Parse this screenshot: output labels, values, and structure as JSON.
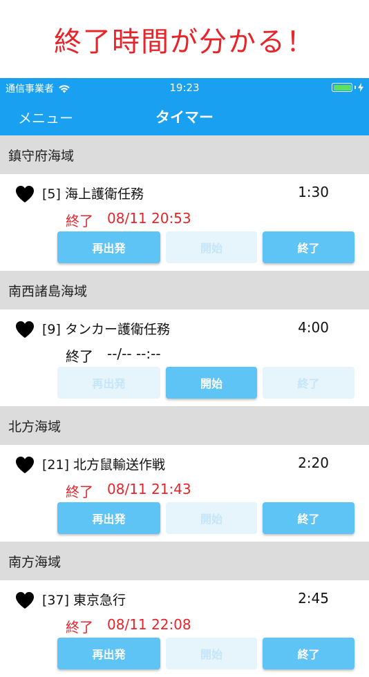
{
  "promo": {
    "text": "終了時間が分かる！"
  },
  "status_bar": {
    "carrier": "通信事業者",
    "time": "19:23"
  },
  "nav": {
    "menu_label": "メニュー",
    "title": "タイマー"
  },
  "sections": [
    {
      "header": "鎮守府海域",
      "item": {
        "name": "[5] 海上護衛任務",
        "duration": "1:30",
        "end_label": "終了",
        "end_time": "08/11 20:53",
        "end_color": "#e8242b",
        "buttons": [
          {
            "label": "再出発",
            "enabled": true
          },
          {
            "label": "開始",
            "enabled": false
          },
          {
            "label": "終了",
            "enabled": true
          }
        ]
      }
    },
    {
      "header": "南西諸島海域",
      "item": {
        "name": "[9] タンカー護衛任務",
        "duration": "4:00",
        "end_label": "終了",
        "end_time": "--/-- --:--",
        "end_color": "#111111",
        "buttons": [
          {
            "label": "再出発",
            "enabled": false
          },
          {
            "label": "開始",
            "enabled": true
          },
          {
            "label": "終了",
            "enabled": false
          }
        ]
      }
    },
    {
      "header": "北方海域",
      "item": {
        "name": "[21] 北方鼠輸送作戦",
        "duration": "2:20",
        "end_label": "終了",
        "end_time": "08/11 21:43",
        "end_color": "#e8242b",
        "buttons": [
          {
            "label": "再出発",
            "enabled": true
          },
          {
            "label": "開始",
            "enabled": false
          },
          {
            "label": "終了",
            "enabled": true
          }
        ]
      }
    },
    {
      "header": "南方海域",
      "item": {
        "name": "[37] 東京急行",
        "duration": "2:45",
        "end_label": "終了",
        "end_time": "08/11 22:08",
        "end_color": "#e8242b",
        "buttons": [
          {
            "label": "再出発",
            "enabled": true
          },
          {
            "label": "開始",
            "enabled": false
          },
          {
            "label": "終了",
            "enabled": true
          }
        ]
      }
    }
  ],
  "colors": {
    "accent": "#1aa0f0",
    "button_active": "#5ec3f5",
    "button_disabled": "#e6f4fc",
    "promo_red": "#e8242b"
  }
}
